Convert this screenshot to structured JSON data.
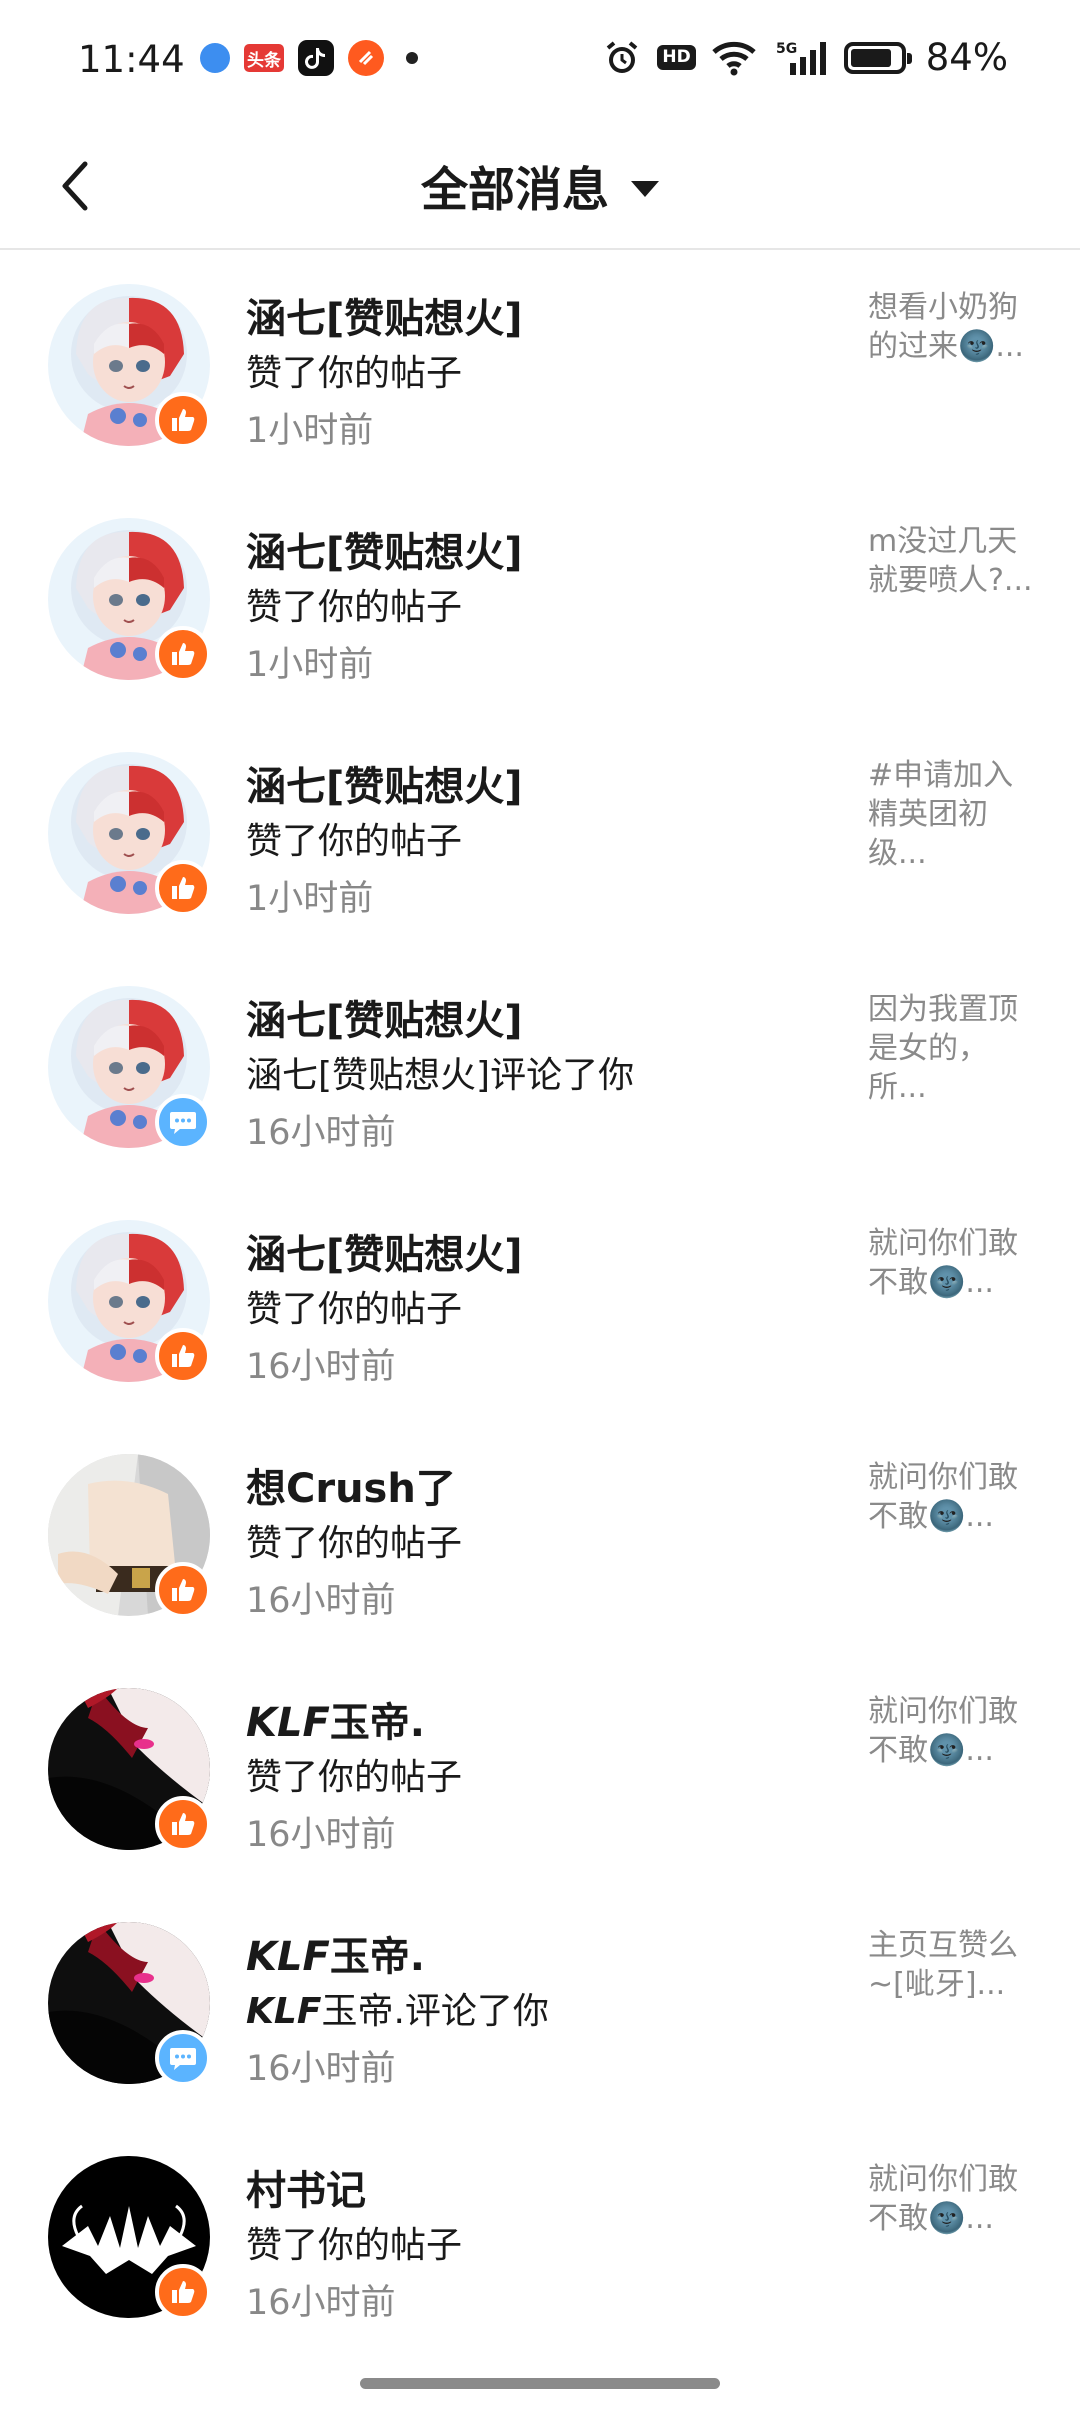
{
  "status_bar": {
    "time": "11:44",
    "apps": [
      "blue-bubble-app-icon",
      "toutiao-app-icon",
      "tiktok-app-icon",
      "orange-app-icon"
    ],
    "toutiao_label": "头条",
    "network": "5G",
    "hd_label": "HD",
    "battery": "84%",
    "battery_level": 0.84
  },
  "nav": {
    "title": "全部消息",
    "back_icon": "chevron-left-icon",
    "dropdown_icon": "caret-down-icon"
  },
  "messages": [
    {
      "name": "涵七[赞贴想火]",
      "action": "赞了你的帖子",
      "time": "1小时前",
      "preview": "想看小奶狗的过来🌚...",
      "badge": "like",
      "avatar": "anime-avatar-redwhite"
    },
    {
      "name": "涵七[赞贴想火]",
      "action": "赞了你的帖子",
      "time": "1小时前",
      "preview": "m没过几天就要喷人?...",
      "badge": "like",
      "avatar": "anime-avatar-redwhite"
    },
    {
      "name": "涵七[赞贴想火]",
      "action": "赞了你的帖子",
      "time": "1小时前",
      "preview": "#申请加入精英团初级...",
      "badge": "like",
      "avatar": "anime-avatar-redwhite"
    },
    {
      "name": "涵七[赞贴想火]",
      "action": "涵七[赞贴想火]评论了你",
      "time": "16小时前",
      "preview": "因为我置顶是女的，所...",
      "badge": "comment",
      "avatar": "anime-avatar-redwhite"
    },
    {
      "name": "涵七[赞贴想火]",
      "action": "赞了你的帖子",
      "time": "16小时前",
      "preview": " 就问你们敢不敢🌚...",
      "badge": "like",
      "avatar": "anime-avatar-redwhite"
    },
    {
      "name": "想Crush了",
      "action": "赞了你的帖子",
      "time": "16小时前",
      "preview": " 就问你们敢不敢🌚...",
      "badge": "like",
      "avatar": "photo-avatar-waist"
    },
    {
      "name_prefix": "KLF",
      "name": "玉帝.",
      "action_prefix": "",
      "action": "赞了你的帖子",
      "time": "16小时前",
      "preview": " 就问你们敢不敢🌚...",
      "badge": "like",
      "avatar": "anime-avatar-darkred"
    },
    {
      "name_prefix": "KLF",
      "name": "玉帝.",
      "action_prefix": "KLF",
      "action": "玉帝.评论了你",
      "time": "16小时前",
      "preview": "主页互赞么~[呲牙]...",
      "badge": "comment",
      "avatar": "anime-avatar-darkred"
    },
    {
      "name": "村书记",
      "action": "赞了你的帖子",
      "time": "16小时前",
      "preview": " 就问你们敢不敢🌚...",
      "badge": "like",
      "avatar": "black-white-logo-avatar"
    }
  ],
  "colors": {
    "like_badge": "#ff6b1a",
    "comment_badge": "#5bb4ff",
    "time_text": "#888888"
  }
}
